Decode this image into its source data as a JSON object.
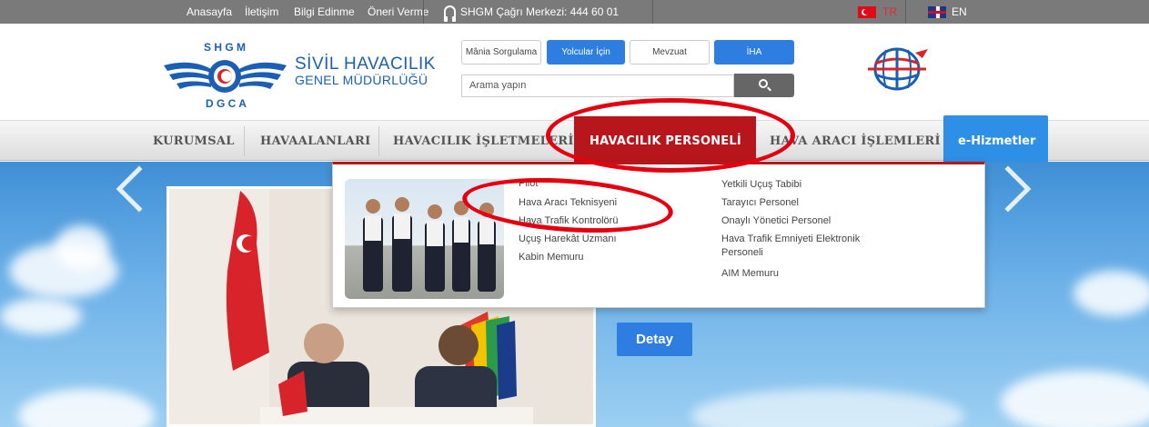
{
  "topbar": {
    "links": [
      "Anasayfa",
      "İletişim",
      "Bilgi Edinme",
      "Öneri Verme"
    ],
    "call_center": "SHGM Çağrı Merkezi: 444 60 01",
    "lang_tr": "TR",
    "lang_en": "EN"
  },
  "header": {
    "logo_line1": "SİVİL HAVACILIK",
    "logo_line2": "GENEL MÜDÜRLÜĞÜ",
    "logo_arc_top": "S H G M",
    "logo_arc_bottom": "D G C A",
    "buttons": [
      "Mânia Sorgulama",
      "Yolcular İçin",
      "Mevzuat",
      "İHA"
    ],
    "search_placeholder": "Arama yapın"
  },
  "nav": {
    "items": [
      "KURUMSAL",
      "HAVAALANLARI",
      "HAVACILIK İŞLETMELERİ",
      "HAVACILIK PERSONELİ",
      "HAVA ARACI İŞLEMLERİ",
      "e-Hizmetler"
    ],
    "active": "HAVACILIK PERSONELİ"
  },
  "dropdown": {
    "col1": [
      "Pilot",
      "Hava Aracı Teknisyeni",
      "Hava Trafik Kontrolörü",
      "Uçuş Harekât Uzmanı",
      "Kabin Memuru"
    ],
    "col2": [
      "Yetkili Uçuş Tabibi",
      "Tarayıcı Personel",
      "Onaylı Yönetici Personel",
      "Hava Trafik Emniyeti Elektronik",
      "Personeli",
      "AIM Memuru"
    ]
  },
  "hero": {
    "detail_button": "Detay"
  },
  "colors": {
    "brand_blue": "#2d7ee0",
    "active_red": "#b8161d",
    "annotation_red": "#e5000f"
  }
}
